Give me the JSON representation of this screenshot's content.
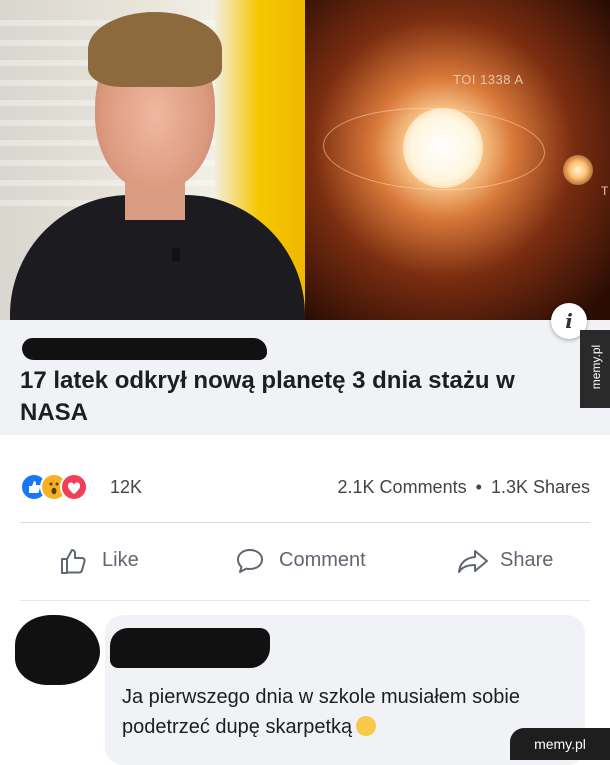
{
  "image": {
    "planet_label": "TOI 1338 A",
    "edge_label": "T"
  },
  "link_preview": {
    "headline": "17 latek odkrył nową planetę 3 dnia stażu w NASA",
    "info_button_label": "i"
  },
  "reactions": {
    "icons": [
      "like-icon",
      "wow-icon",
      "love-icon"
    ],
    "count": "12K",
    "comments": "2.1K Comments",
    "separator": "•",
    "shares": "1.3K Shares"
  },
  "actions": {
    "like_label": "Like",
    "comment_label": "Comment",
    "share_label": "Share"
  },
  "comment": {
    "text": "Ja pierwszego dnia w szkole musiałem sobie podetrzeć dupę skarpetką"
  },
  "watermark": {
    "side": "memy.pl",
    "bottom": "memy.pl"
  },
  "colors": {
    "like_blue": "#1877f2",
    "love_red": "#f33e58",
    "wow_yellow": "#f7b125",
    "text_gray": "#606770"
  }
}
